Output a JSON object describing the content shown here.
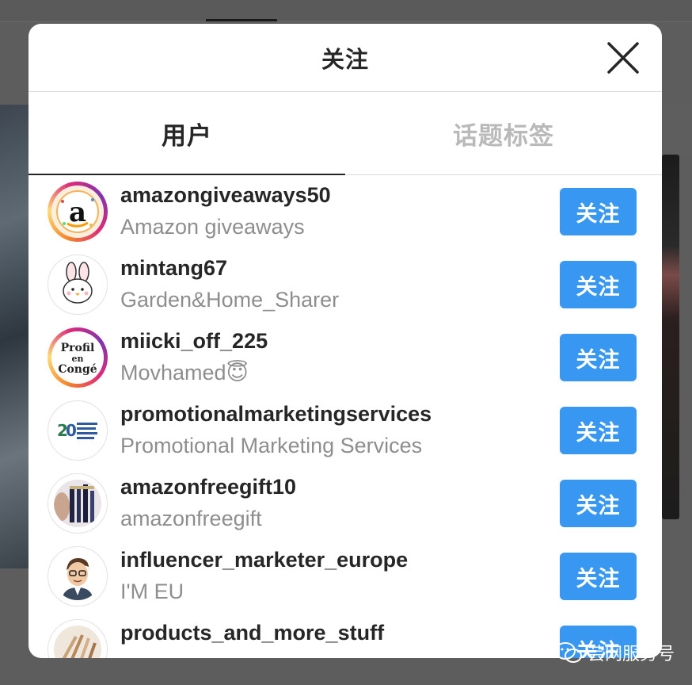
{
  "modal": {
    "title": "关注",
    "close_icon": "close-icon"
  },
  "tabs": [
    {
      "label": "用户",
      "active": true
    },
    {
      "label": "话题标签",
      "active": false
    }
  ],
  "follow_label": "关注",
  "users": [
    {
      "username": "amazongiveaways50",
      "fullname": "Amazon giveaways",
      "avatar_ring": true,
      "avatar_icon": "amazon-logo-avatar"
    },
    {
      "username": "mintang67",
      "fullname": "Garden&Home_Sharer",
      "avatar_ring": false,
      "avatar_icon": "bunny-chick-avatar"
    },
    {
      "username": "miicki_off_225",
      "fullname": "Movhamed😇",
      "avatar_ring": true,
      "avatar_icon": "profil-en-conge-avatar"
    },
    {
      "username": "promotionalmarketingservices",
      "fullname": "Promotional Marketing Services",
      "avatar_ring": false,
      "avatar_icon": "20-promo-logo-avatar"
    },
    {
      "username": "amazonfreegift10",
      "fullname": "amazonfreegift",
      "avatar_ring": false,
      "avatar_icon": "mascara-products-avatar"
    },
    {
      "username": "influencer_marketer_europe",
      "fullname": "I'M EU",
      "avatar_ring": false,
      "avatar_icon": "cartoon-man-avatar"
    },
    {
      "username": "products_and_more_stuff",
      "fullname": "",
      "avatar_ring": false,
      "avatar_icon": "brushes-avatar"
    }
  ],
  "watermark": {
    "text": "芸网服务号",
    "icon": "wechat-icon"
  },
  "colors": {
    "follow_button": "#3897f0",
    "overlay": "#5d5d5d",
    "fullname_gray": "#8e8e8e",
    "tab_inactive": "#b9b9b9"
  }
}
